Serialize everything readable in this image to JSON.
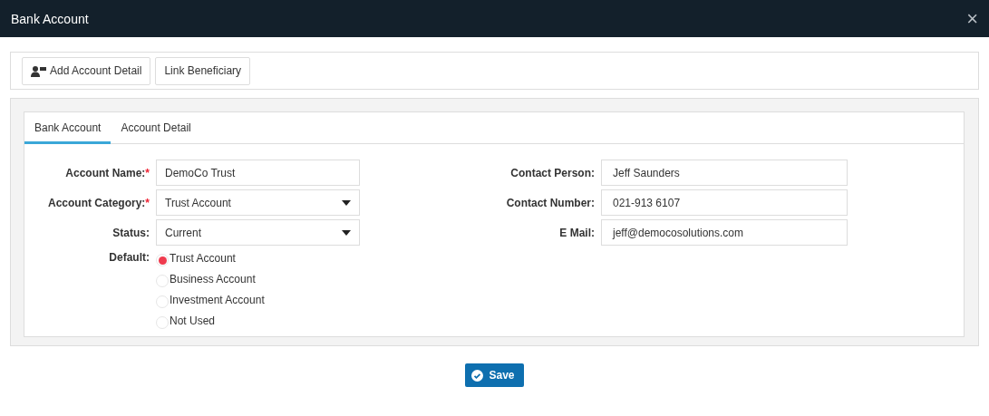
{
  "window": {
    "title": "Bank Account",
    "close": "×"
  },
  "toolbar": [
    {
      "label": "Add Account Detail",
      "kind": "icon"
    },
    {
      "label": "Link Beneficiary",
      "kind": "plain"
    }
  ],
  "tabs": [
    {
      "label": "Bank Account",
      "selected": true
    },
    {
      "label": "Account Detail",
      "selected": false
    }
  ],
  "left_fields": [
    {
      "label": "Account Name:",
      "required_mark": "*",
      "kind": "text",
      "value": "DemoCo Trust"
    },
    {
      "label": "Account Category:",
      "required_mark": "*",
      "kind": "select",
      "value": "Trust Account"
    },
    {
      "label": "Status:",
      "kind": "select",
      "value": "Current"
    }
  ],
  "default": {
    "label": "Default:",
    "options": [
      {
        "label": "Trust Account",
        "selected": true
      },
      {
        "label": "Business Account",
        "selected": false
      },
      {
        "label": "Investment Account",
        "selected": false
      },
      {
        "label": "Not Used",
        "selected": false
      }
    ]
  },
  "right_fields": [
    {
      "label": "Contact Person:",
      "kind": "text",
      "value": "Jeff Saunders"
    },
    {
      "label": "Contact Number:",
      "kind": "text",
      "value": "021-913 6107"
    },
    {
      "label": "E Mail:",
      "kind": "text",
      "value": "jeff@democosolutions.com"
    }
  ],
  "save_button": {
    "label": "Save"
  }
}
